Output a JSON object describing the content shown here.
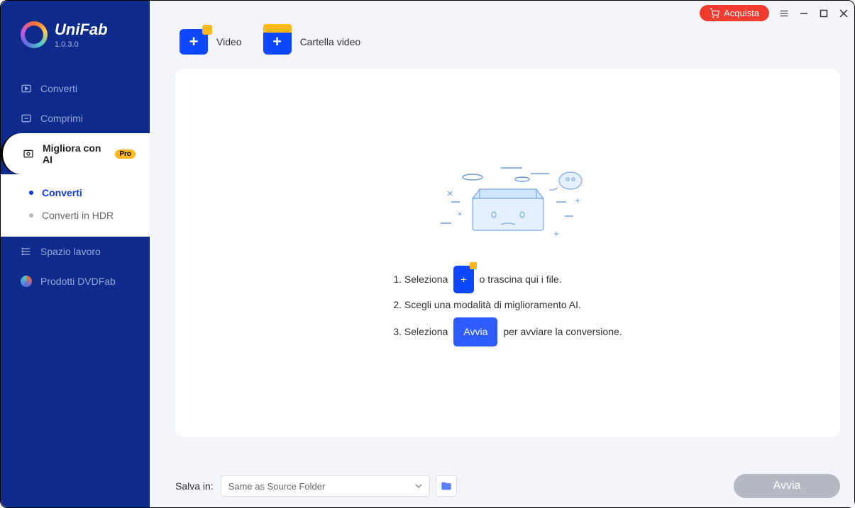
{
  "app": {
    "name": "UniFab",
    "version": "1.0.3.0"
  },
  "titlebar": {
    "buy_label": "Acquista"
  },
  "sidebar": {
    "items": [
      {
        "label": "Converti"
      },
      {
        "label": "Comprimi"
      },
      {
        "label": "Migliora con AI",
        "badge": "Pro"
      },
      {
        "label": "Spazio lavoro"
      },
      {
        "label": "Prodotti DVDFab"
      }
    ],
    "sub_items": [
      {
        "label": "Converti",
        "selected": true
      },
      {
        "label": "Converti in HDR",
        "selected": false
      }
    ]
  },
  "toolbar": {
    "video_label": "Video",
    "folder_label": "Cartella video"
  },
  "steps": {
    "s1_a": "1. Seleziona",
    "s1_b": "o trascina qui i file.",
    "s2": "2. Scegli una modalità di miglioramento AI.",
    "s3_a": "3. Seleziona",
    "s3_btn": "Avvia",
    "s3_b": "per avviare la conversione."
  },
  "footer": {
    "save_label": "Salva in:",
    "save_value": "Same as Source Folder",
    "start_label": "Avvia"
  }
}
